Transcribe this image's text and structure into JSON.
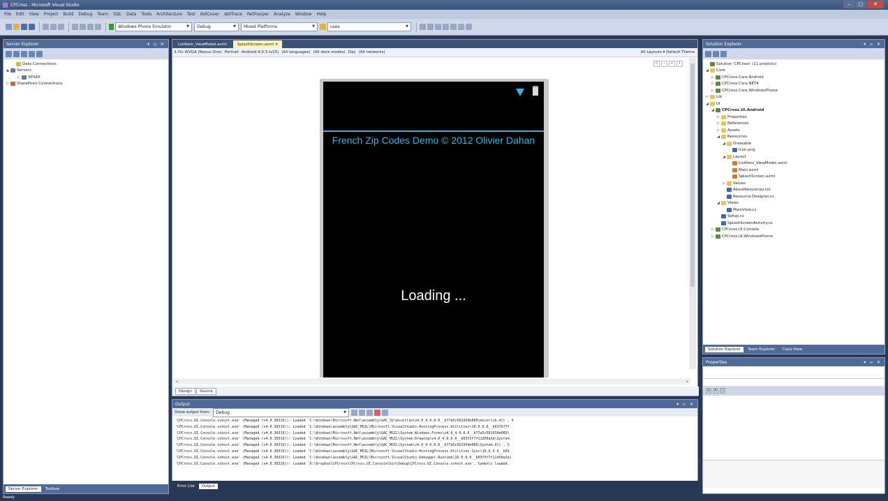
{
  "window": {
    "title": "CPCross - Microsoft Visual Studio"
  },
  "menu": [
    "File",
    "Edit",
    "View",
    "Project",
    "Build",
    "Debug",
    "Team",
    "SQL",
    "Data",
    "Tools",
    "Architecture",
    "Test",
    "dotCover",
    "dotTrace",
    "ReSharper",
    "Analyze",
    "Window",
    "Help"
  ],
  "toolbar": {
    "target": "Windows Phone Emulator",
    "config": "Debug",
    "platform": "Mixed Platforms",
    "find": "uses"
  },
  "server_explorer": {
    "title": "Server Explorer",
    "items": [
      {
        "label": "Data Connections",
        "indent": 1,
        "icon": "db"
      },
      {
        "label": "Servers",
        "indent": 0,
        "icon": "srv",
        "expander": "▲"
      },
      {
        "label": "XPS4X",
        "indent": 2,
        "icon": "srv",
        "expander": "▷"
      },
      {
        "label": "SharePoint Connections",
        "indent": 0,
        "icon": "sp",
        "expander": "▷"
      }
    ],
    "tabs": [
      "Server Explorer",
      "Toolbox"
    ]
  },
  "document": {
    "tabs": [
      "ListItem_ViewModel.axml",
      "SplashScreen.axml"
    ],
    "design_bar": {
      "items": [
        "3.7in WVGA (Nexus One)",
        "Portrait",
        "Android 4.0.3 (v15)",
        "(All languages)",
        "(All dock modes)",
        "Day",
        "(All networks)"
      ],
      "right": "All Layouts ▾ Default Theme"
    },
    "phone": {
      "title": "French Zip Codes Demo © 2012 Olivier Dahan",
      "loading": "Loading ..."
    },
    "bottom_tabs": [
      "Design",
      "Source"
    ]
  },
  "output": {
    "title": "Output",
    "show_from_label": "Show output from:",
    "show_from_value": "Debug",
    "lines": [
      "'CPCross.UI.Console.vshost.exe' (Managed (v4.0.30319)): Loaded 'C:\\Windows\\Microsoft.Net\\assembly\\GAC_32\\mscorlib\\v4.0_4.0.0.0__b77a5c561934e089\\mscorlib.dll', S",
      "'CPCross.UI.Console.vshost.exe' (Managed (v4.0.30319)): Loaded 'C:\\Windows\\assembly\\GAC_MSIL\\Microsoft.VisualStudio.HostingProcess.Utilities\\10.0.0.0__b03f5f7f",
      "'CPCross.UI.Console.vshost.exe' (Managed (v4.0.30319)): Loaded 'C:\\Windows\\Microsoft.Net\\assembly\\GAC_MSIL\\System.Windows.Forms\\v4.0_4.0.0.0__b77a5c561934e089\\",
      "'CPCross.UI.Console.vshost.exe' (Managed (v4.0.30319)): Loaded 'C:\\Windows\\Microsoft.Net\\assembly\\GAC_MSIL\\System.Drawing\\v4.0_4.0.0.0__b03f5f7f11d50a3a\\System.",
      "'CPCross.UI.Console.vshost.exe' (Managed (v4.0.30319)): Loaded 'C:\\Windows\\Microsoft.Net\\assembly\\GAC_MSIL\\System\\v4.0_4.0.0.0__b77a5c561934e089\\System.dll', S",
      "'CPCross.UI.Console.vshost.exe' (Managed (v4.0.30319)): Loaded 'C:\\Windows\\assembly\\GAC_MSIL\\Microsoft.VisualStudio.HostingProcess.Utilities.Sync\\10.0.0.0__b03",
      "'CPCross.UI.Console.vshost.exe' (Managed (v4.0.30319)): Loaded 'C:\\Windows\\assembly\\GAC_MSIL\\Microsoft.VisualStudio.Debugger.Runtime\\10.0.0.0__b03f5f7f11d50a3a\\",
      "'CPCross.UI.Console.vshost.exe' (Managed (v4.0.30319)): Loaded 'D:\\Dropbox\\CPCross\\CPCross.UI.Console\\bin\\Debug\\CPCross.UI.Console.vshost.exe', Symbols loaded."
    ],
    "tabs": [
      "Error List",
      "Output"
    ]
  },
  "solution_explorer": {
    "title": "Solution Explorer",
    "items": [
      {
        "label": "Solution 'CPCross' (11 projects)",
        "indent": 0,
        "icon": "proj"
      },
      {
        "label": "Core",
        "indent": 0,
        "icon": "folder",
        "expander": "◢"
      },
      {
        "label": "CPCross.Core.Android",
        "indent": 1,
        "icon": "proj",
        "expander": "▷"
      },
      {
        "label": "CPCross.Core.NET4",
        "indent": 1,
        "icon": "proj",
        "expander": "▷"
      },
      {
        "label": "CPCross.Core.WindowsPhone",
        "indent": 1,
        "icon": "proj",
        "expander": "▷"
      },
      {
        "label": "Lib",
        "indent": 0,
        "icon": "folder",
        "expander": "▷"
      },
      {
        "label": "UI",
        "indent": 0,
        "icon": "folder",
        "expander": "◢"
      },
      {
        "label": "CPCross.UI.Android",
        "indent": 1,
        "icon": "proj",
        "expander": "◢",
        "bold": true
      },
      {
        "label": "Properties",
        "indent": 2,
        "icon": "folder",
        "expander": "▷"
      },
      {
        "label": "References",
        "indent": 2,
        "icon": "folder",
        "expander": "▷"
      },
      {
        "label": "Assets",
        "indent": 2,
        "icon": "folder",
        "expander": "▷"
      },
      {
        "label": "Resources",
        "indent": 2,
        "icon": "folder",
        "expander": "◢"
      },
      {
        "label": "Drawable",
        "indent": 3,
        "icon": "folder",
        "expander": "◢"
      },
      {
        "label": "Icon.png",
        "indent": 4,
        "icon": "cs"
      },
      {
        "label": "Layout",
        "indent": 3,
        "icon": "folder",
        "expander": "◢"
      },
      {
        "label": "ListItem_ViewModel.axml",
        "indent": 4,
        "icon": "xml"
      },
      {
        "label": "Main.axml",
        "indent": 4,
        "icon": "xml"
      },
      {
        "label": "SplashScreen.axml",
        "indent": 4,
        "icon": "xml"
      },
      {
        "label": "Values",
        "indent": 3,
        "icon": "folder",
        "expander": "▷"
      },
      {
        "label": "AboutResources.txt",
        "indent": 3,
        "icon": "cs"
      },
      {
        "label": "Resource.Designer.cs",
        "indent": 3,
        "icon": "cs"
      },
      {
        "label": "Views",
        "indent": 2,
        "icon": "folder",
        "expander": "◢"
      },
      {
        "label": "MainView.cs",
        "indent": 3,
        "icon": "cs"
      },
      {
        "label": "Setup.cs",
        "indent": 2,
        "icon": "cs"
      },
      {
        "label": "SplashScreenActivity.cs",
        "indent": 2,
        "icon": "cs"
      },
      {
        "label": "CPCross.UI.Console",
        "indent": 1,
        "icon": "proj",
        "expander": "▷"
      },
      {
        "label": "CPCross.UI.WindowsPhone",
        "indent": 1,
        "icon": "proj",
        "expander": "▷"
      }
    ],
    "tabs": [
      "Solution Explorer",
      "Team Explorer",
      "Class View"
    ]
  },
  "properties": {
    "title": "Properties"
  },
  "status": {
    "text": "Ready"
  },
  "colors": {
    "accent": "#33b5e5",
    "chrome": "#293955",
    "phone_bg": "#000000"
  }
}
